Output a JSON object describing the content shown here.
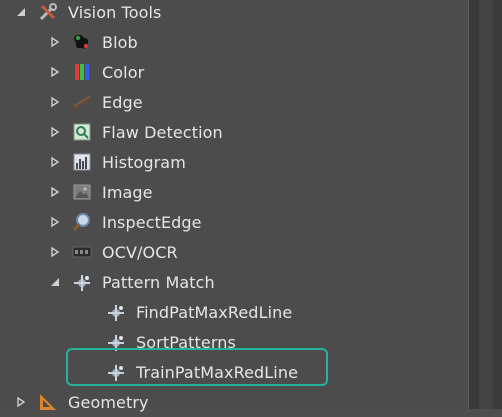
{
  "tree": {
    "vision_tools": "Vision Tools",
    "blob": "Blob",
    "color": "Color",
    "edge": "Edge",
    "flaw_detection": "Flaw Detection",
    "histogram": "Histogram",
    "image": "Image",
    "inspect_edge": "InspectEdge",
    "ocv_ocr": "OCV/OCR",
    "pattern_match": "Pattern Match",
    "find_pat": "FindPatMaxRedLine",
    "sort_patterns": "SortPatterns",
    "train_pat": "TrainPatMaxRedLine",
    "geometry": "Geometry"
  },
  "colors": {
    "background": "#4c4c4c",
    "text": "#e6e6e6",
    "selection_outline": "#27b39a"
  },
  "icons": {
    "vision_tools": "tools-icon",
    "blob": "blob-icon",
    "color": "color-bars-icon",
    "edge": "edge-icon",
    "flaw_detection": "flaw-detection-icon",
    "histogram": "histogram-icon",
    "image": "image-icon",
    "inspect_edge": "magnifier-icon",
    "ocv_ocr": "ocr-icon",
    "pattern_match": "pattern-match-icon",
    "geometry": "geometry-icon"
  }
}
